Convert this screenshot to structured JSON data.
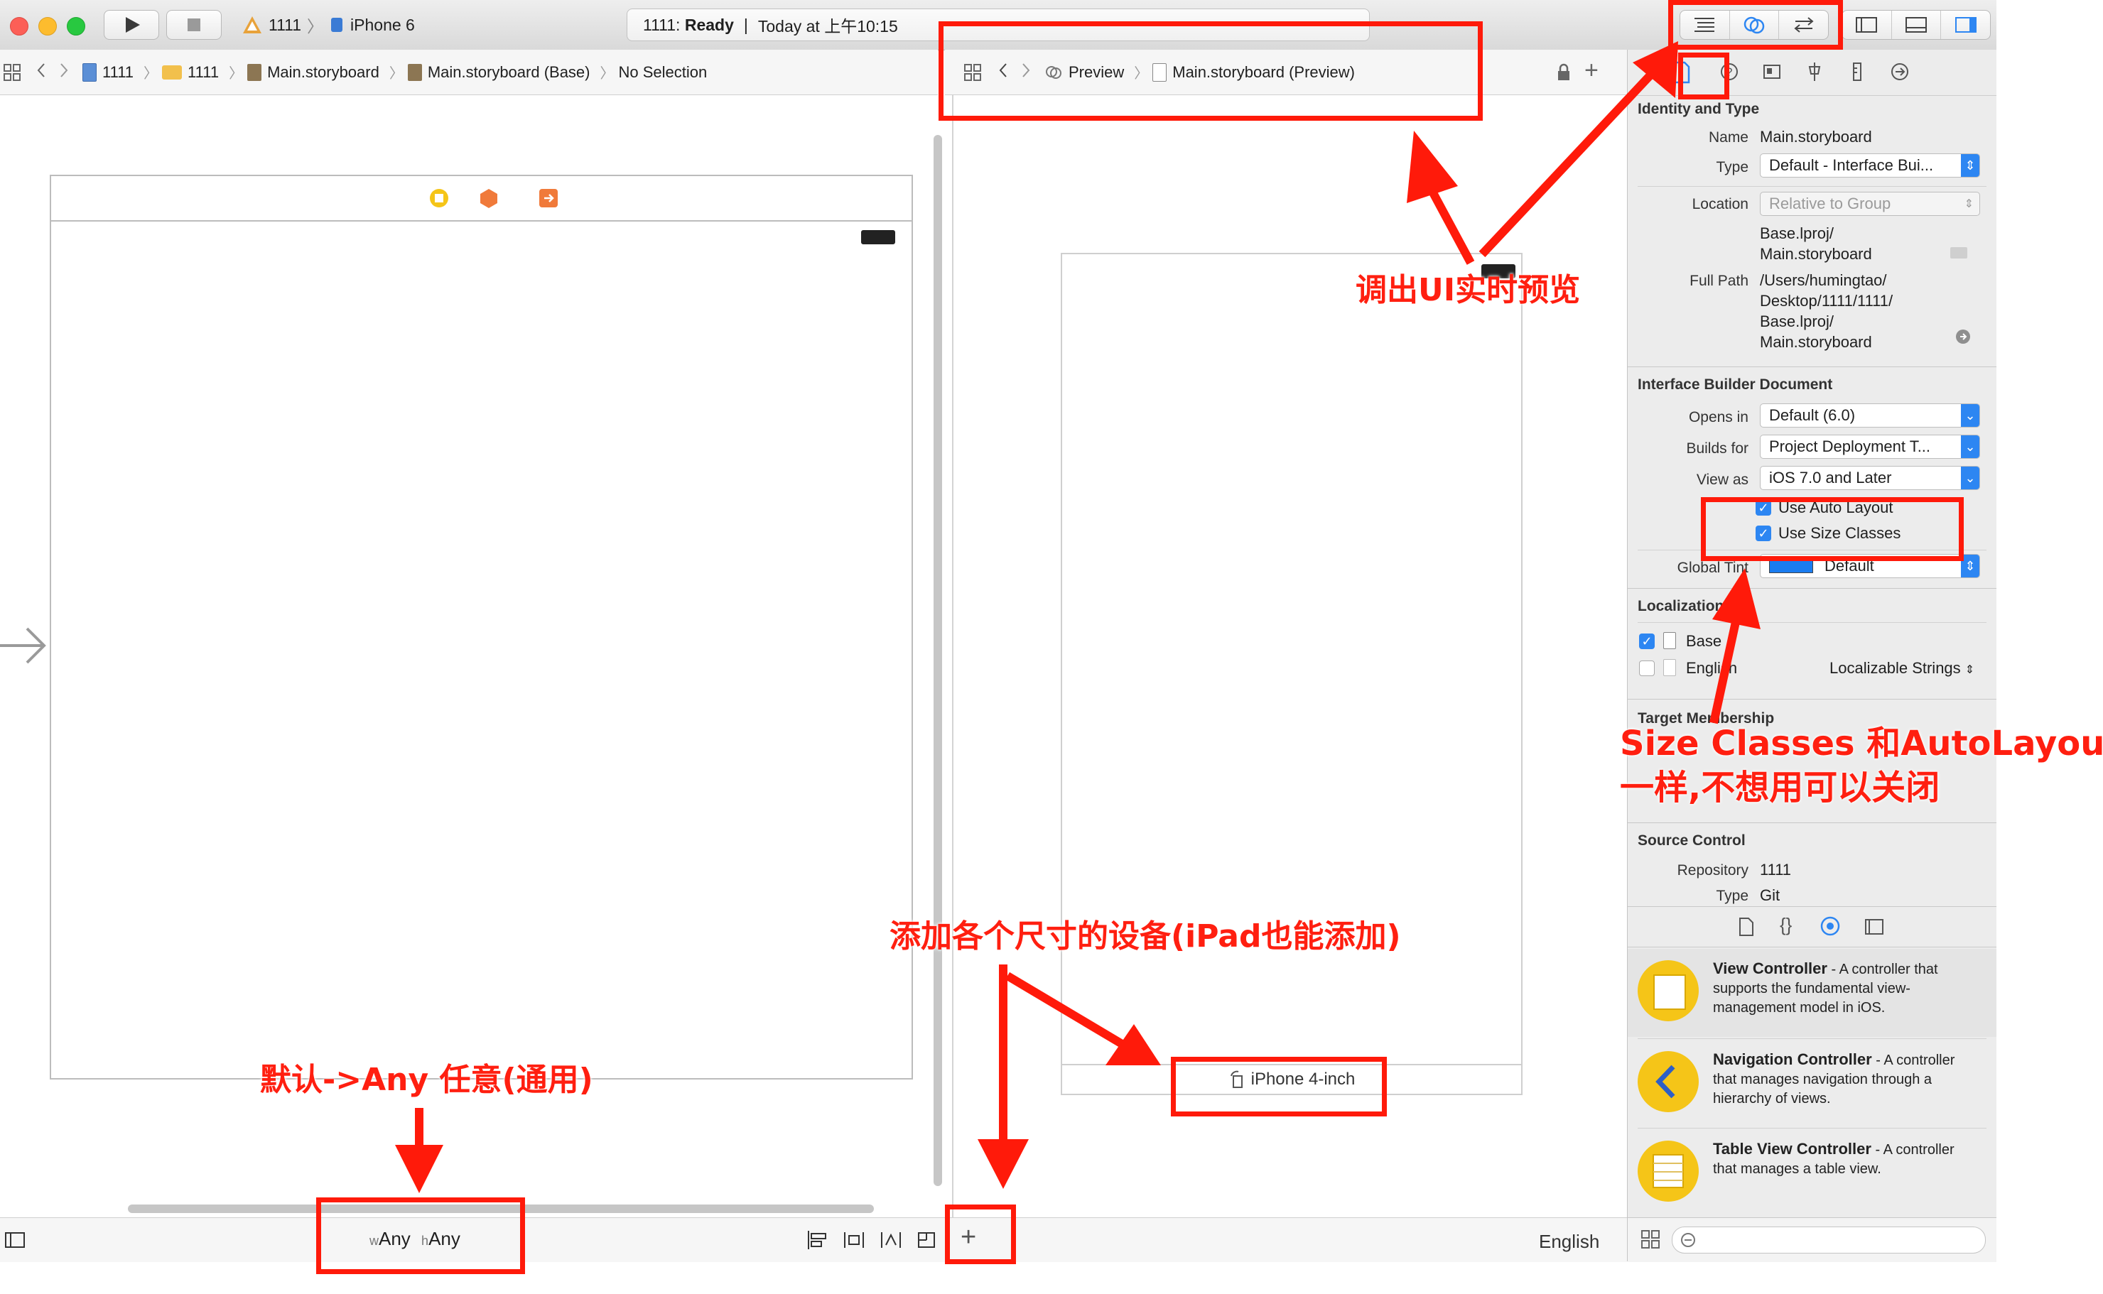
{
  "toolbar": {
    "scheme_project": "1111",
    "scheme_device": "iPhone 6",
    "activity_status_prefix": "1111: ",
    "activity_status": "Ready",
    "activity_sep": "|",
    "activity_time": "Today at 上午10:15"
  },
  "jumpbar_left": {
    "items": [
      "1111",
      "1111",
      "Main.storyboard",
      "Main.storyboard (Base)",
      "No Selection"
    ]
  },
  "jumpbar_preview": {
    "items": [
      "Preview",
      "Main.storyboard (Preview)"
    ]
  },
  "preview": {
    "device_label": "iPhone 4-inch"
  },
  "bottombar": {
    "size_w_prefix": "w",
    "size_w": "Any",
    "size_h_prefix": "h",
    "size_h": "Any",
    "add_button": "+",
    "language": "English"
  },
  "inspector": {
    "identity_title": "Identity and Type",
    "name_label": "Name",
    "name_value": "Main.storyboard",
    "type_label": "Type",
    "type_value": "Default - Interface Bui...",
    "location_label": "Location",
    "location_value": "Relative to Group",
    "location_path_1": "Base.lproj/",
    "location_path_2": "Main.storyboard",
    "fullpath_label": "Full Path",
    "fullpath_1": "/Users/humingtao/",
    "fullpath_2": "Desktop/1111/1111/",
    "fullpath_3": "Base.lproj/",
    "fullpath_4": "Main.storyboard",
    "ib_title": "Interface Builder Document",
    "opens_label": "Opens in",
    "opens_value": "Default (6.0)",
    "builds_label": "Builds for",
    "builds_value": "Project Deployment T...",
    "viewas_label": "View as",
    "viewas_value": "iOS 7.0 and Later",
    "autolayout_label": "Use Auto Layout",
    "sizeclasses_label": "Use Size Classes",
    "tint_label": "Global Tint",
    "tint_value": "Default",
    "tint_color": "#1a7cf0",
    "localization_title": "Localization",
    "loc_base": "Base",
    "loc_english": "English",
    "loc_strings": "Localizable Strings",
    "target_title": "Target Membership",
    "source_title": "Source Control",
    "repo_label": "Repository",
    "repo_value": "1111",
    "sc_type_label": "Type",
    "sc_type_value": "Git"
  },
  "library": [
    {
      "title": "View Controller",
      "desc": " - A controller that supports the fundamental view-management model in iOS."
    },
    {
      "title": "Navigation Controller",
      "desc": " - A controller that manages navigation through a hierarchy of views."
    },
    {
      "title": "Table View Controller",
      "desc": " - A controller that manages a table view."
    }
  ],
  "annotations": {
    "preview_note": "调出UI实时预览",
    "sizeclass_note_1": "Size Classes 和AutoLayout",
    "sizeclass_note_2": "一样,不想用可以关闭",
    "add_device_note": "添加各个尺寸的设备(iPad也能添加)",
    "default_any_note": "默认->Any 任意(通用)",
    "annotation_color": "#ff1a0a"
  }
}
